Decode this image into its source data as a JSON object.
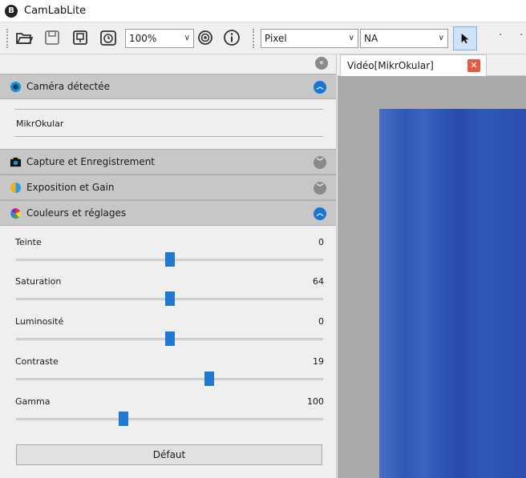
{
  "app": {
    "title": "CamLabLite",
    "icon": "B"
  },
  "toolbar": {
    "zoom": "100%",
    "unit": "Pixel",
    "calibration": "NA",
    "icons": [
      "open-folder-icon",
      "save-icon",
      "save-video-icon",
      "timer-icon",
      "settings-gear-icon",
      "info-icon",
      "pointer-icon"
    ]
  },
  "panel": {
    "sections": {
      "camera": {
        "label": "Caméra détectée",
        "device": "MikrOkular"
      },
      "capture": {
        "label": "Capture et Enregistrement"
      },
      "exposure": {
        "label": "Exposition et Gain"
      },
      "colors": {
        "label": "Couleurs et réglages"
      }
    },
    "sliders": [
      {
        "label": "Teinte",
        "value": "0",
        "level": 0.5
      },
      {
        "label": "Saturation",
        "value": "64",
        "level": 0.5
      },
      {
        "label": "Luminosité",
        "value": "0",
        "level": 0.5
      },
      {
        "label": "Contraste",
        "value": "19",
        "level": 0.63
      },
      {
        "label": "Gamma",
        "value": "100",
        "level": 0.35
      }
    ],
    "default_button": "Défaut"
  },
  "video": {
    "tab_label": "Vidéo[MikrOkular]",
    "close_glyph": "✕"
  },
  "colors": {
    "accent": "#1f78d1",
    "close": "#e35b45",
    "video_blue": "#2f58b8"
  }
}
